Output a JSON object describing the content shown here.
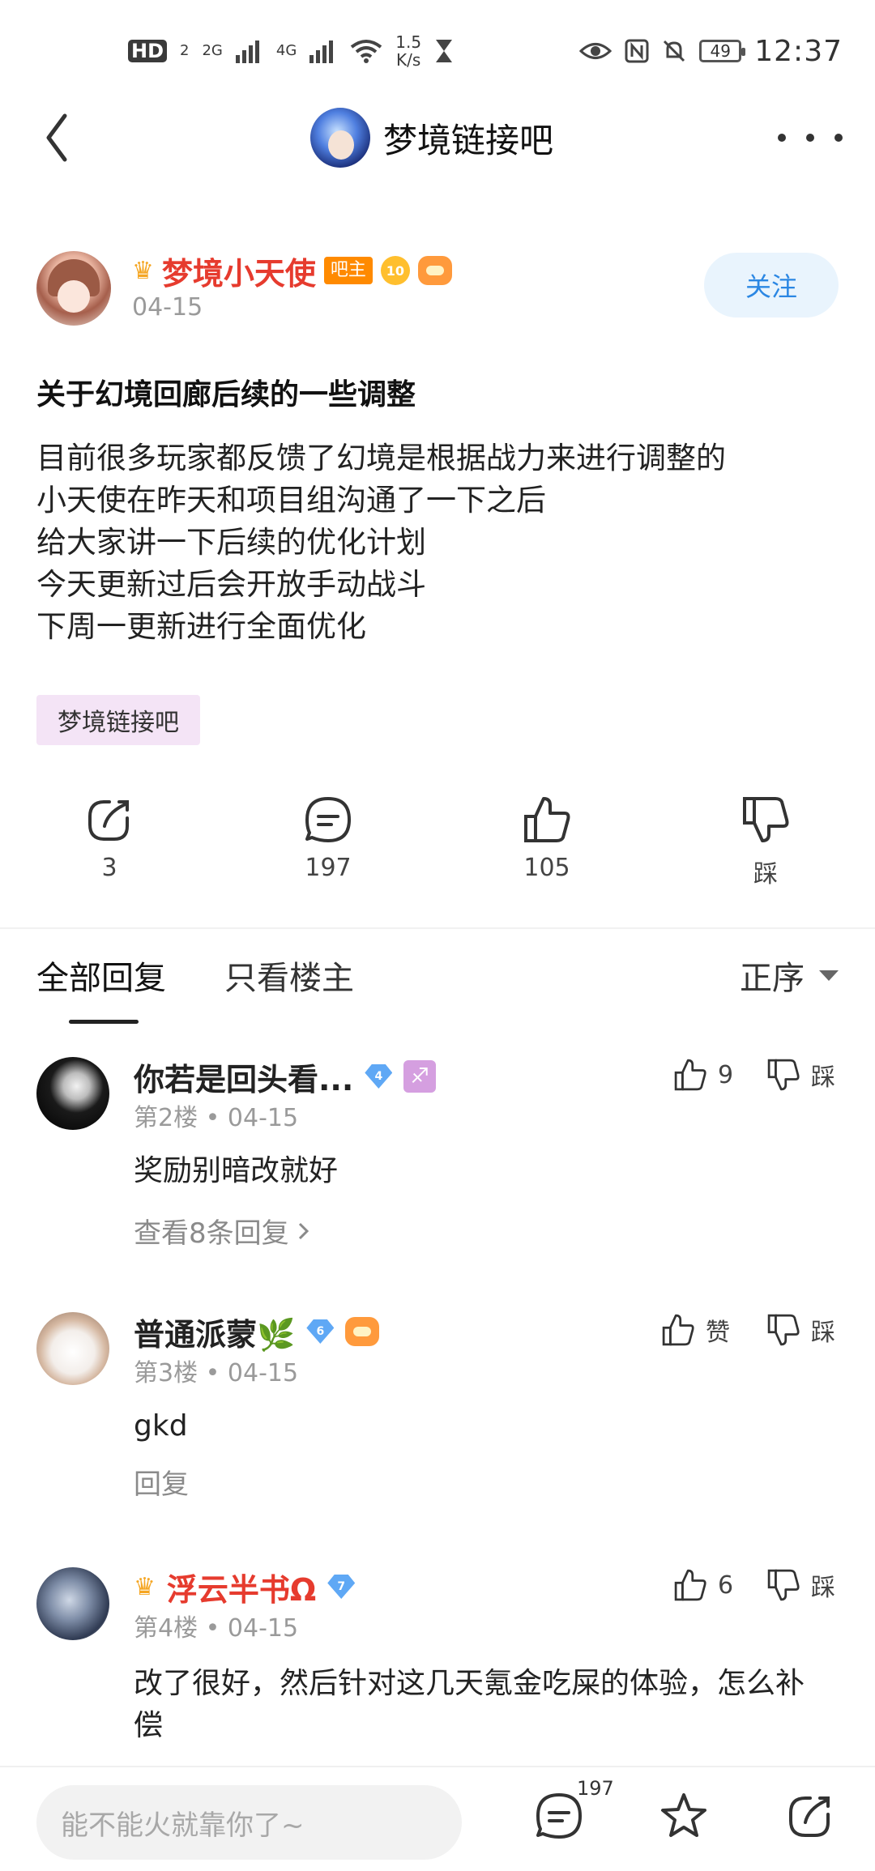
{
  "status_bar": {
    "hd": "HD",
    "hd_sub": "2",
    "net1": "2G",
    "net2": "4G",
    "speed_value": "1.5",
    "speed_unit": "K/s",
    "battery": "49",
    "time": "12:37"
  },
  "header": {
    "forum_name": "梦境链接吧"
  },
  "post": {
    "author": "梦境小天使",
    "owner_badge": "吧主",
    "level": "10",
    "date": "04-15",
    "follow_label": "关注",
    "title": "关于幻境回廊后续的一些调整",
    "body": [
      "目前很多玩家都反馈了幻境是根据战力来进行调整的",
      "小天使在昨天和项目组沟通了一下之后",
      "给大家讲一下后续的优化计划",
      "今天更新过后会开放手动战斗",
      "下周一更新进行全面优化"
    ],
    "tag": "梦境链接吧",
    "actions": {
      "share_count": "3",
      "comment_count": "197",
      "like_count": "105",
      "dislike_label": "踩"
    }
  },
  "tabs": {
    "all": "全部回复",
    "op_only": "只看楼主",
    "sort": "正序"
  },
  "replies": [
    {
      "name": "你若是回头看...",
      "level": "4",
      "floor": "第2楼",
      "date": "04-15",
      "text": "奖励别暗改就好",
      "sub": "查看8条回复",
      "likes": "9",
      "dislike": "踩"
    },
    {
      "name": "普通派蒙🌿",
      "level": "6",
      "floor": "第3楼",
      "date": "04-15",
      "text": "gkd",
      "sub": "回复",
      "likes": "赞",
      "dislike": "踩"
    },
    {
      "name": "浮云半书Ω",
      "level": "7",
      "floor": "第4楼",
      "date": "04-15",
      "text": "改了很好，然后针对这几天氪金吃屎的体验，怎么补偿",
      "likes": "6",
      "dislike": "踩"
    }
  ],
  "bottom": {
    "placeholder": "能不能火就靠你了~",
    "comment_count": "197"
  },
  "meta_sep": "•"
}
